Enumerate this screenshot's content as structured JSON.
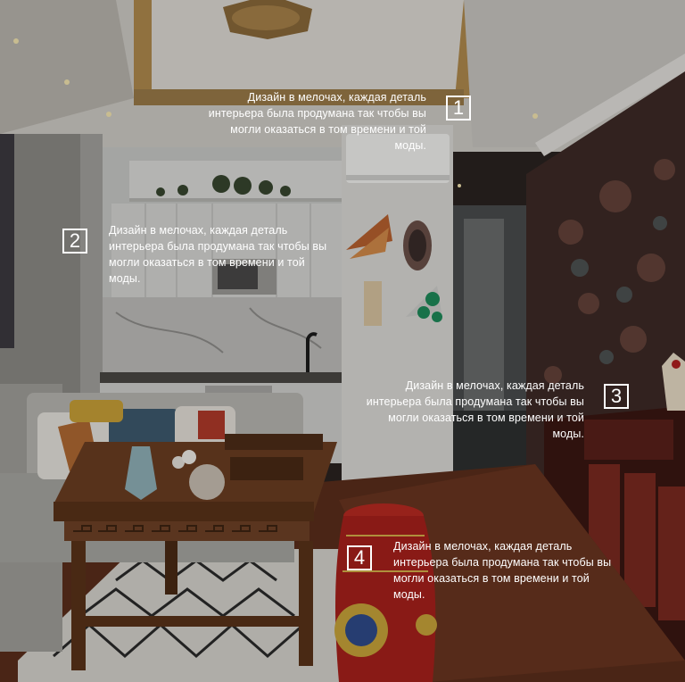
{
  "colors": {
    "text": "#ffffff",
    "ceiling": "#d9d6d0",
    "wall_left": "#8f8e8a",
    "wallpaper": "#3a2622",
    "floor": "#5a2e1c",
    "kitchen_white": "#d2d3d0",
    "stool_red": "#a6201c"
  },
  "annotations": [
    {
      "number": "1",
      "lines": [
        "Дизайн в мелочах, каждая деталь",
        "интерьера была продумана так чтобы вы",
        "могли оказаться в том времени и той",
        "моды."
      ]
    },
    {
      "number": "2",
      "lines": [
        "Дизайн в мелочах, каждая деталь",
        "интерьера была продумана так чтобы вы",
        "могли оказаться в том времени и той",
        "моды."
      ]
    },
    {
      "number": "3",
      "lines": [
        "Дизайн в мелочах, каждая деталь",
        "интерьера была продумана так чтобы вы",
        "могли оказаться в том времени и той",
        "моды."
      ]
    },
    {
      "number": "4",
      "lines": [
        "Дизайн в мелочах, каждая деталь",
        "интерьера была продумана так чтобы вы",
        "могли оказаться в том времени и той",
        "моды."
      ]
    }
  ]
}
